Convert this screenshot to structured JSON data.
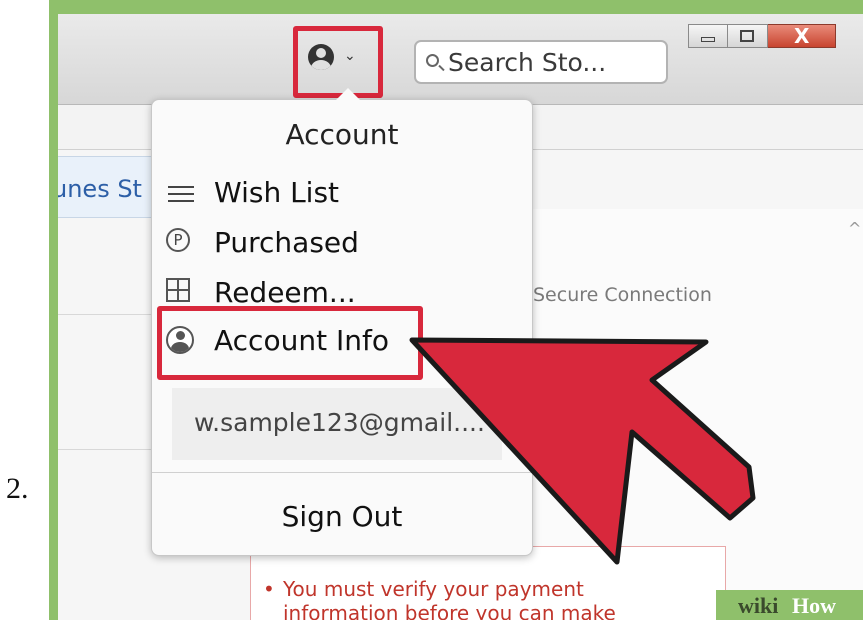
{
  "step": {
    "number": "2."
  },
  "toolbar": {
    "search_placeholder": "Search Sto...",
    "window_close_symbol": "X"
  },
  "sidebar": {
    "store_tab_label": "unes St"
  },
  "content": {
    "secure_connection": "Secure Connection",
    "warning_text": "You must verify your payment information before you can make"
  },
  "account_menu": {
    "title": "Account",
    "items": [
      {
        "label": "Wish List",
        "icon": "list-icon"
      },
      {
        "label": "Purchased",
        "icon": "purchased-icon"
      },
      {
        "label": "Redeem...",
        "icon": "gift-icon"
      },
      {
        "label": "Account Info",
        "icon": "user-icon"
      }
    ],
    "email": "w.sample123@gmail....",
    "sign_out": "Sign Out"
  },
  "annotations": {
    "highlight_color": "#d8283c",
    "arrow_color": "#d8283c"
  },
  "watermark": {
    "wiki": "wiki",
    "how": "How"
  }
}
